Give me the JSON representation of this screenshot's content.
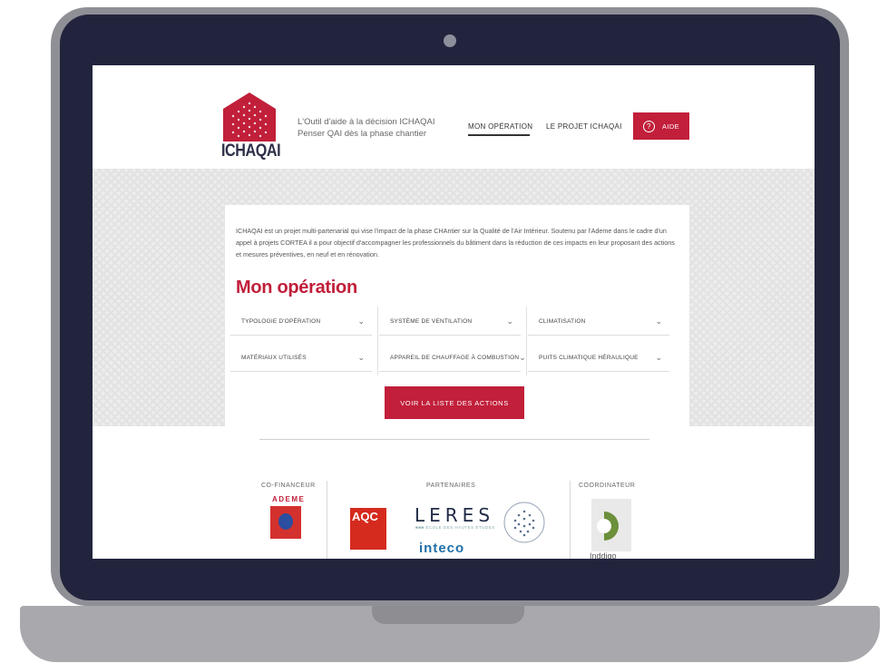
{
  "header": {
    "logo_text": "ICHAQAI",
    "tagline_line1": "L'Outil d'aide à la décision ICHAQAI",
    "tagline_line2": "Penser QAI dès la phase chantier",
    "nav": {
      "operation": "MON OPÉRATION",
      "project": "LE PROJET ICHAQAI",
      "help": "AIDE",
      "help_icon_glyph": "?"
    }
  },
  "main": {
    "intro": "ICHAQAI est un projet multi-partenarial qui vise l'impact de la phase CHAntier sur la Qualité de l'Air Intérieur. Soutenu par l'Ademe dans le cadre d'un appel à projets CORTEA il a pour objectif d'accompagner les professionnels du bâtiment dans la réduction de ces impacts en leur proposant des actions et mesures préventives, en neuf et en rénovation.",
    "title": "Mon opération",
    "selects": [
      "TYPOLOGIE D'OPÉRATION",
      "SYSTÈME DE VENTILATION",
      "CLIMATISATION",
      "MATÉRIAUX UTILISÉS",
      "APPAREIL DE CHAUFFAGE À COMBUSTION",
      "PUITS CLIMATIQUE HÉRAULIQUE"
    ],
    "actions_button": "VOIR LA LISTE DES ACTIONS"
  },
  "footer": {
    "cofinancer_label": "CO-FINANCEUR",
    "partners_label": "PARTENAIRES",
    "coordinator_label": "COORDINATEUR",
    "ademe": "ADEME",
    "aqc": "AQC",
    "leres": "LERES",
    "leres_sub": "■■■ ÉCOLE DES HAUTES ÉTUDES",
    "inteco": "inteco",
    "coordinator": "Inddigo"
  },
  "colors": {
    "brand_red": "#c11f3a",
    "navy": "#2d2f48",
    "bezel": "#22243d"
  }
}
